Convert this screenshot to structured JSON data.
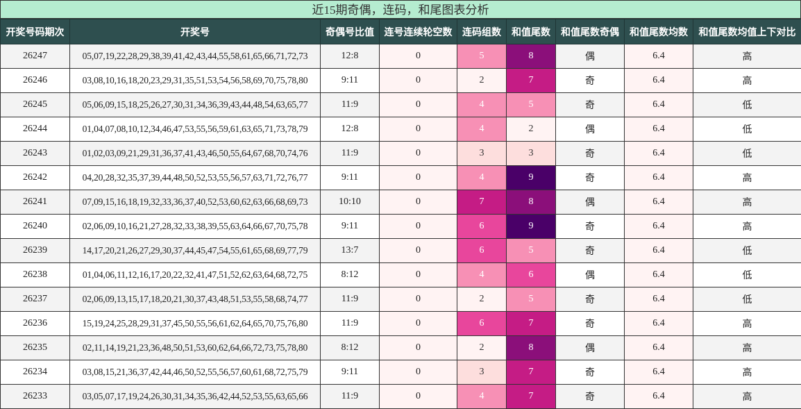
{
  "title": "近15期奇偶，连码，和尾图表分析",
  "headers": [
    "开奖号码期次",
    "开奖号",
    "奇偶号比值",
    "连号连续轮空数",
    "连码组数",
    "和值尾数",
    "和值尾数奇偶",
    "和值尾数均数",
    "和值尾数均值上下对比"
  ],
  "colors": {
    "title_bg": "#b5ecd0",
    "header_bg": "#2e4f4f",
    "heat_2": "#fff3f3",
    "heat_3": "#fddedd",
    "heat_4": "#f790b5",
    "heat_5": "#f790b5",
    "heat_5_alt": "#e8469c",
    "heat_6": "#e8469c",
    "heat_7": "#c51c85",
    "heat_8": "#8b0f7a",
    "heat_9": "#4a0068"
  },
  "rows": [
    {
      "issue": "26247",
      "numbers": "05,07,19,22,28,29,38,39,41,42,43,44,55,58,61,65,66,71,72,73",
      "ratio": "12:8",
      "gap": "0",
      "lian": "5",
      "tail": "8",
      "parity": "偶",
      "avg": "6.4",
      "cmp": "高"
    },
    {
      "issue": "26246",
      "numbers": "03,08,10,16,18,20,23,29,31,35,51,53,54,56,58,69,70,75,78,80",
      "ratio": "9:11",
      "gap": "0",
      "lian": "2",
      "tail": "7",
      "parity": "奇",
      "avg": "6.4",
      "cmp": "高"
    },
    {
      "issue": "26245",
      "numbers": "05,06,09,15,18,25,26,27,30,31,34,36,39,43,44,48,54,63,65,77",
      "ratio": "11:9",
      "gap": "0",
      "lian": "4",
      "tail": "5",
      "parity": "奇",
      "avg": "6.4",
      "cmp": "低"
    },
    {
      "issue": "26244",
      "numbers": "01,04,07,08,10,12,34,46,47,53,55,56,59,61,63,65,71,73,78,79",
      "ratio": "12:8",
      "gap": "0",
      "lian": "4",
      "tail": "2",
      "parity": "偶",
      "avg": "6.4",
      "cmp": "低"
    },
    {
      "issue": "26243",
      "numbers": "01,02,03,09,21,29,31,36,37,41,43,46,50,55,64,67,68,70,74,76",
      "ratio": "11:9",
      "gap": "0",
      "lian": "3",
      "tail": "3",
      "parity": "奇",
      "avg": "6.4",
      "cmp": "低"
    },
    {
      "issue": "26242",
      "numbers": "04,20,28,32,35,37,39,44,48,50,52,53,55,56,57,63,71,72,76,77",
      "ratio": "9:11",
      "gap": "0",
      "lian": "4",
      "tail": "9",
      "parity": "奇",
      "avg": "6.4",
      "cmp": "高"
    },
    {
      "issue": "26241",
      "numbers": "07,09,15,16,18,19,32,33,36,37,40,52,53,60,62,63,66,68,69,73",
      "ratio": "10:10",
      "gap": "0",
      "lian": "7",
      "tail": "8",
      "parity": "偶",
      "avg": "6.4",
      "cmp": "高"
    },
    {
      "issue": "26240",
      "numbers": "02,06,09,10,16,21,27,28,32,33,38,39,55,63,64,66,67,70,75,78",
      "ratio": "9:11",
      "gap": "0",
      "lian": "6",
      "tail": "9",
      "parity": "奇",
      "avg": "6.4",
      "cmp": "高"
    },
    {
      "issue": "26239",
      "numbers": "14,17,20,21,26,27,29,30,37,44,45,47,54,55,61,65,68,69,77,79",
      "ratio": "13:7",
      "gap": "0",
      "lian": "6",
      "tail": "5",
      "parity": "奇",
      "avg": "6.4",
      "cmp": "低"
    },
    {
      "issue": "26238",
      "numbers": "01,04,06,11,12,16,17,20,22,32,41,47,51,52,62,63,64,68,72,75",
      "ratio": "8:12",
      "gap": "0",
      "lian": "4",
      "tail": "6",
      "parity": "偶",
      "avg": "6.4",
      "cmp": "低"
    },
    {
      "issue": "26237",
      "numbers": "02,06,09,13,15,17,18,20,21,30,37,43,48,51,53,55,58,68,74,77",
      "ratio": "11:9",
      "gap": "0",
      "lian": "2",
      "tail": "5",
      "parity": "奇",
      "avg": "6.4",
      "cmp": "低"
    },
    {
      "issue": "26236",
      "numbers": "15,19,24,25,28,29,31,37,45,50,55,56,61,62,64,65,70,75,76,80",
      "ratio": "11:9",
      "gap": "0",
      "lian": "6",
      "tail": "7",
      "parity": "奇",
      "avg": "6.4",
      "cmp": "高"
    },
    {
      "issue": "26235",
      "numbers": "02,11,14,19,21,23,36,48,50,51,53,60,62,64,66,72,73,75,78,80",
      "ratio": "8:12",
      "gap": "0",
      "lian": "2",
      "tail": "8",
      "parity": "偶",
      "avg": "6.4",
      "cmp": "高"
    },
    {
      "issue": "26234",
      "numbers": "03,08,15,21,36,37,42,44,46,50,52,55,56,57,60,61,68,72,75,79",
      "ratio": "9:11",
      "gap": "0",
      "lian": "3",
      "tail": "7",
      "parity": "奇",
      "avg": "6.4",
      "cmp": "高"
    },
    {
      "issue": "26233",
      "numbers": "03,05,07,17,19,24,26,30,31,34,35,36,42,44,52,53,55,63,65,66",
      "ratio": "11:9",
      "gap": "0",
      "lian": "4",
      "tail": "7",
      "parity": "奇",
      "avg": "6.4",
      "cmp": "高"
    }
  ]
}
